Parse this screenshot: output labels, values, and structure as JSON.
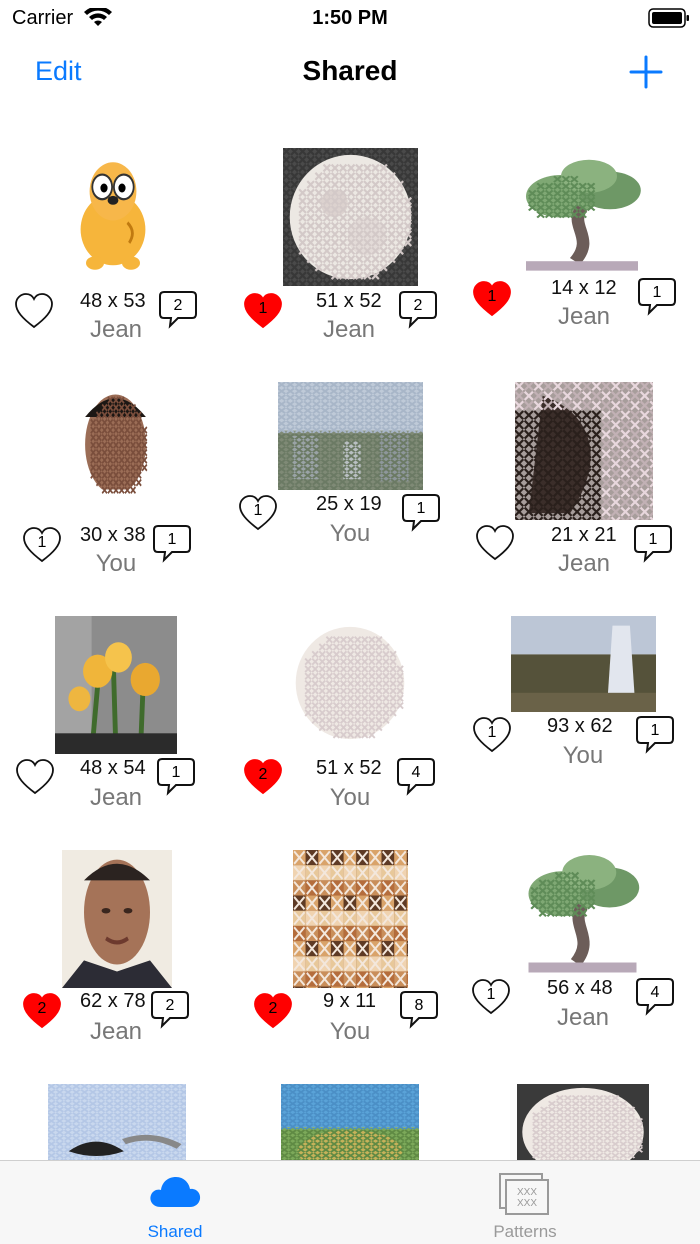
{
  "status": {
    "carrier": "Carrier",
    "time": "1:50 PM"
  },
  "nav": {
    "edit_label": "Edit",
    "title": "Shared",
    "add_icon": "plus-icon"
  },
  "colors": {
    "accent": "#0a7aff",
    "liked_heart": "#ff0000",
    "owner_text": "#777777"
  },
  "patterns": [
    {
      "dims": "48 x 53",
      "owner": "Jean",
      "likes": "",
      "liked": false,
      "comments": "2",
      "art": "cartoon-dog"
    },
    {
      "dims": "51 x 52",
      "owner": "Jean",
      "likes": "1",
      "liked": true,
      "comments": "2",
      "art": "moon-dark"
    },
    {
      "dims": "14 x 12",
      "owner": "Jean",
      "likes": "1",
      "liked": true,
      "comments": "1",
      "art": "bonsai"
    },
    {
      "dims": "30 x 38",
      "owner": "You",
      "likes": "1",
      "liked": false,
      "comments": "1",
      "art": "portrait"
    },
    {
      "dims": "25 x 19",
      "owner": "You",
      "likes": "1",
      "liked": false,
      "comments": "1",
      "art": "cityscape"
    },
    {
      "dims": "21 x 21",
      "owner": "Jean",
      "likes": "",
      "liked": false,
      "comments": "1",
      "art": "flowers-cross"
    },
    {
      "dims": "48 x 54",
      "owner": "Jean",
      "likes": "",
      "liked": false,
      "comments": "1",
      "art": "daffodils"
    },
    {
      "dims": "51 x 52",
      "owner": "You",
      "likes": "2",
      "liked": true,
      "comments": "4",
      "art": "moon"
    },
    {
      "dims": "93 x 62",
      "owner": "You",
      "likes": "1",
      "liked": false,
      "comments": "1",
      "art": "waterfall"
    },
    {
      "dims": "62 x 78",
      "owner": "Jean",
      "likes": "2",
      "liked": true,
      "comments": "2",
      "art": "portrait-photo"
    },
    {
      "dims": "9 x 11",
      "owner": "You",
      "likes": "2",
      "liked": true,
      "comments": "8",
      "art": "mosaic"
    },
    {
      "dims": "56 x 48",
      "owner": "Jean",
      "likes": "1",
      "liked": false,
      "comments": "4",
      "art": "bonsai-large"
    },
    {
      "dims": "",
      "owner": "",
      "likes": "",
      "liked": false,
      "comments": "",
      "art": "sky-bird"
    },
    {
      "dims": "",
      "owner": "",
      "likes": "",
      "liked": false,
      "comments": "",
      "art": "landscape-sky"
    },
    {
      "dims": "",
      "owner": "",
      "likes": "",
      "liked": false,
      "comments": "",
      "art": "moon-partial"
    }
  ],
  "tabs": [
    {
      "label": "Shared",
      "icon": "cloud-icon",
      "active": true
    },
    {
      "label": "Patterns",
      "icon": "patterns-icon",
      "active": false
    }
  ]
}
